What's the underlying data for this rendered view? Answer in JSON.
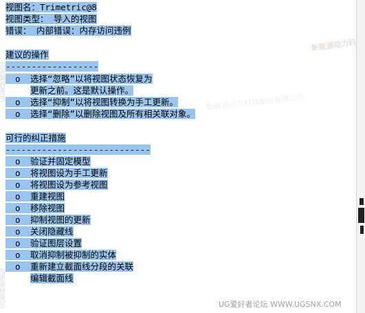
{
  "info": {
    "view_name": "视图名：Trimetric@8",
    "view_type": "视图类型： 导入的视图",
    "error": "错误： 内部错误：内存访问违例",
    "suggested_heading": "建议的操作",
    "suggested_rule": "------------------",
    "suggested_items": [
      {
        "bullet": "o",
        "text": "选择“忽略”以将视图状态恢复为"
      },
      {
        "bullet": "",
        "text": "更新之前。这是默认操作。"
      },
      {
        "bullet": "o",
        "text": "选择“抑制”以将视图转换为手工更新。"
      },
      {
        "bullet": "o",
        "text": "选择“删除”以删除视图及所有相关联对象。"
      }
    ],
    "corrective_heading": "可行的纠正措施",
    "corrective_rule": "----------------------------",
    "corrective_items": [
      {
        "bullet": "o",
        "text": "验证并固定模型"
      },
      {
        "bullet": "o",
        "text": "将视图设为手工更新"
      },
      {
        "bullet": "o",
        "text": "将视图设为参考视图"
      },
      {
        "bullet": "o",
        "text": "重建视图"
      },
      {
        "bullet": "o",
        "text": "移除视图"
      },
      {
        "bullet": "o",
        "text": "抑制视图的更新"
      },
      {
        "bullet": "o",
        "text": "关闭隐藏线"
      },
      {
        "bullet": "o",
        "text": "验证图层设置"
      },
      {
        "bullet": "o",
        "text": "取消抑制被抑制的实体"
      },
      {
        "bullet": "o",
        "text": "重新建立截面线分段的关联"
      },
      {
        "bullet": "",
        "text": "编辑截面线"
      }
    ]
  },
  "watermarks": {
    "forum": "UG爱好者论坛 WWW.UGSNX.COM",
    "company": "新能源动力科技股份有限公司",
    "side": "UG爱好者论坛"
  },
  "colors": {
    "selection": "#99c4ee",
    "background": "#ffffff"
  }
}
